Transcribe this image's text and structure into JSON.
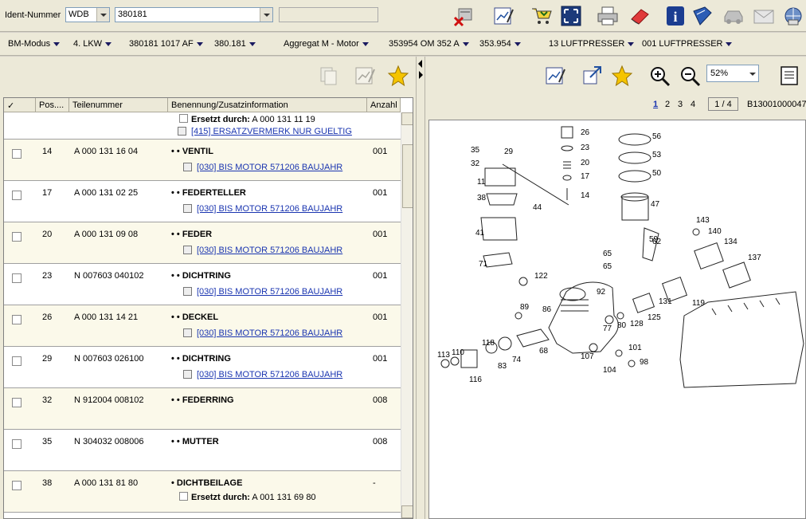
{
  "toolbar": {
    "ident_label": "Ident-Nummer",
    "prefix_value": "WDB",
    "number_value": "380181"
  },
  "breadcrumb": [
    "BM-Modus",
    "4. LKW",
    "380181 1017 AF",
    "380.181",
    "Aggregat M  - Motor",
    "353954 OM 352 A",
    "353.954",
    "13 LUFTPRESSER",
    "001 LUFTPRESSER"
  ],
  "grid": {
    "headers": [
      "✓",
      "Pos....",
      "Teilenummer",
      "Benennung/Zusatzinformation",
      "Anzahl"
    ],
    "partial_top": {
      "replaced_label": "Ersetzt durch:",
      "replaced_value": "A 000 131 11 19",
      "note": "[415] ERSATZVERMERK NUR GUELTIG"
    },
    "rows": [
      {
        "pos": "14",
        "part": "A 000 131 16 04",
        "name": "• •  VENTIL",
        "qty": "001",
        "note": "[030] BIS MOTOR 571206 BAUJAHR"
      },
      {
        "pos": "17",
        "part": "A 000 131 02 25",
        "name": "• •  FEDERTELLER",
        "qty": "001",
        "note": "[030] BIS MOTOR 571206 BAUJAHR"
      },
      {
        "pos": "20",
        "part": "A 000 131 09 08",
        "name": "• •  FEDER",
        "qty": "001",
        "note": "[030] BIS MOTOR 571206 BAUJAHR"
      },
      {
        "pos": "23",
        "part": "N 007603 040102",
        "name": "• •  DICHTRING",
        "qty": "001",
        "note": "[030] BIS MOTOR 571206 BAUJAHR"
      },
      {
        "pos": "26",
        "part": "A 000 131 14 21",
        "name": "• •  DECKEL",
        "qty": "001",
        "note": "[030] BIS MOTOR 571206 BAUJAHR"
      },
      {
        "pos": "29",
        "part": "N 007603 026100",
        "name": "• •  DICHTRING",
        "qty": "001",
        "note": "[030] BIS MOTOR 571206 BAUJAHR"
      },
      {
        "pos": "32",
        "part": "N 912004 008102",
        "name": "• •  FEDERRING",
        "qty": "008",
        "note": ""
      },
      {
        "pos": "35",
        "part": "N 304032 008006",
        "name": "• •  MUTTER",
        "qty": "008",
        "note": ""
      },
      {
        "pos": "38",
        "part": "A 000 131 81 80",
        "name": "•  DICHTBEILAGE",
        "qty": "-",
        "note": ""
      }
    ],
    "last_replaced_label": "Ersetzt durch:",
    "last_replaced_value": "A 001 131 69 80"
  },
  "viewer": {
    "zoom": "52%",
    "pages": [
      "1",
      "2",
      "3",
      "4"
    ],
    "current_page": "1",
    "page_indicator": "1 / 4",
    "image_code": "B13001000047",
    "callouts": [
      "26",
      "23",
      "20",
      "17",
      "14",
      "35",
      "29",
      "32",
      "11",
      "38",
      "44",
      "41",
      "71",
      "56",
      "53",
      "50",
      "47",
      "143",
      "140",
      "134",
      "137",
      "59",
      "62",
      "65",
      "65",
      "122",
      "92",
      "131",
      "119",
      "89",
      "86",
      "77",
      "80",
      "128",
      "125",
      "118",
      "110",
      "113",
      "83",
      "74",
      "68",
      "107",
      "101",
      "104",
      "98",
      "116"
    ]
  },
  "colors": {
    "chrome": "#ece9d8",
    "link": "#1a35b0",
    "row_alt": "#fbf9ea"
  }
}
